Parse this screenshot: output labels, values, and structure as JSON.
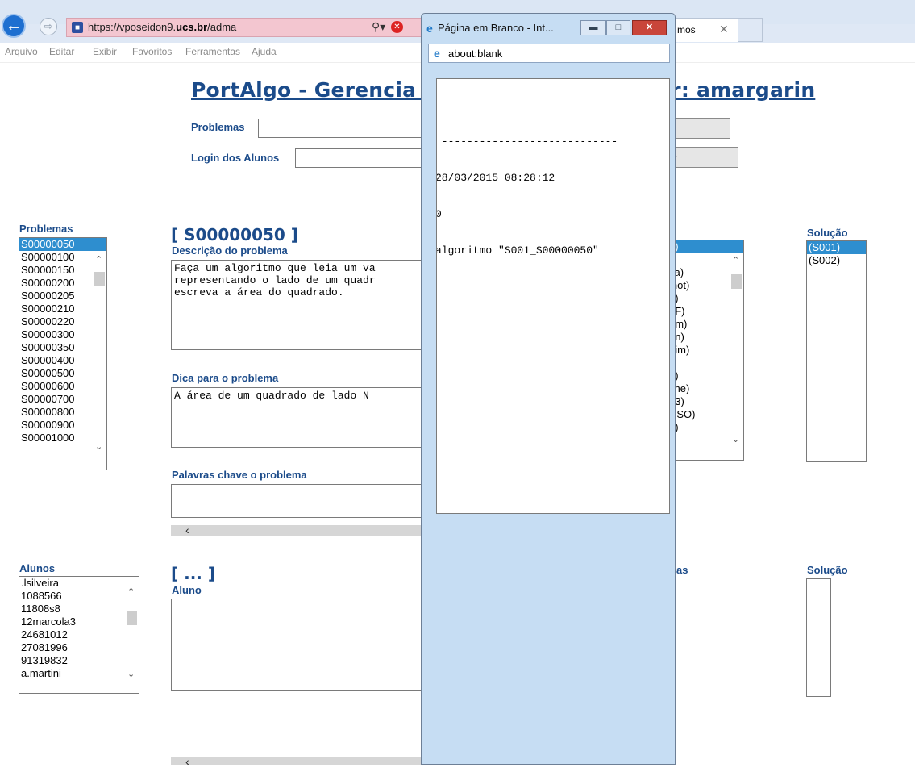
{
  "browser": {
    "url_prefix": "https://vposeidon9.",
    "url_domain": "ucs.br",
    "url_suffix": "/adma",
    "tab_label": "mos",
    "menu": [
      "Arquivo",
      "Editar",
      "Exibir",
      "Favoritos",
      "Ferramentas",
      "Ajuda"
    ]
  },
  "popup": {
    "title": "Página em Branco - Int...",
    "address": "about:blank",
    "output_lines": [
      " ----------------------------",
      "28/03/2015 08:28:12",
      "0",
      "algoritmo \"S001_S00000050\""
    ]
  },
  "page": {
    "title": "PortAlgo - Gerencia de Envios - Supervisor: amargarin",
    "problems_filter_label": "Problemas",
    "students_filter_label": "Login dos Alunos",
    "students_button_fragment": "r",
    "problems_list_label": "Problemas",
    "problems": [
      "S00000050",
      "S00000100",
      "S00000150",
      "S00000200",
      "S00000205",
      "S00000210",
      "S00000220",
      "S00000300",
      "S00000350",
      "S00000400",
      "S00000500",
      "S00000600",
      "S00000700",
      "S00000800",
      "S00000900",
      "S00001000"
    ],
    "selected_problem": "[ S00000050 ]",
    "description_label": "Descrição do problema",
    "description_text": "Faça um algoritmo que leia um va\nrepresentando o lado de um quadr\nescreva a área do quadrado.",
    "hint_label": "Dica para o problema",
    "hint_text": "A área de um quadrado de lado N ",
    "keywords_label": "Palavras chave o problema",
    "submitters_visible": [
      "6)",
      ")",
      "va)",
      "inot)",
      "5)",
      "_F)",
      "dm)",
      "on)",
      "uim)",
      ")",
      "a)",
      "che)",
      "13)",
      "CSO)",
      "7)"
    ],
    "solution_label": "Solução",
    "solutions": [
      "(S001)",
      "(S002)"
    ],
    "students_list_label": "Alunos",
    "students": [
      ".lsilveira",
      "1088566",
      "11808s8",
      "12marcola3",
      "24681012",
      "27081996",
      "91319832",
      "a.martini"
    ],
    "student_heading": "[ ... ]",
    "student_label": "Aluno",
    "student_problems_fragment": "as",
    "student_solution_label": "Solução"
  }
}
